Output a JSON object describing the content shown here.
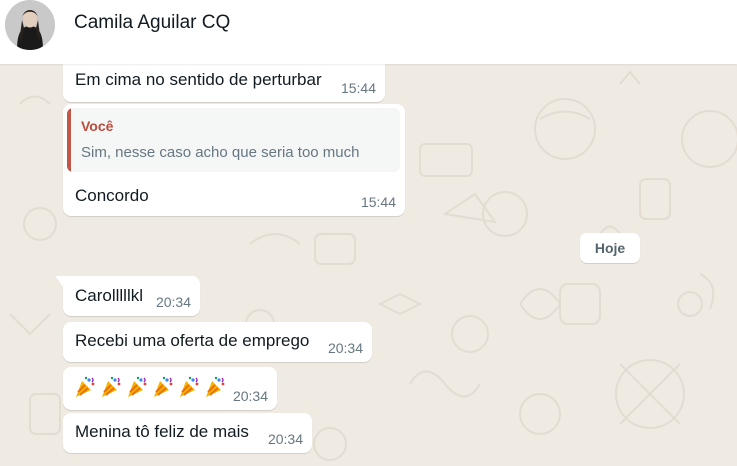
{
  "header": {
    "contact_name": "Camila Aguilar CQ",
    "avatar_icon": "profile-photo"
  },
  "messages": [
    {
      "text": "Em cima no sentido de perturbar",
      "time": "15:44"
    },
    {
      "quote": {
        "author": "Você",
        "text": "Sim, nesse caso acho que seria too much"
      },
      "text": "Concordo",
      "time": "15:44"
    },
    {
      "text": "Carolllllkl",
      "time": "20:34"
    },
    {
      "text": "Recebi uma oferta de emprego",
      "time": "20:34"
    },
    {
      "emoji": "🎉",
      "emoji_name": "party-popper-icon",
      "emoji_count": 6,
      "time": "20:34"
    },
    {
      "text": "Menina tô feliz de mais",
      "time": "20:34"
    }
  ],
  "date_separator": "Hoje",
  "colors": {
    "chat_background": "#efeae2",
    "bubble": "#ffffff",
    "quote_accent": "#c0584a",
    "timestamp": "#667781"
  }
}
